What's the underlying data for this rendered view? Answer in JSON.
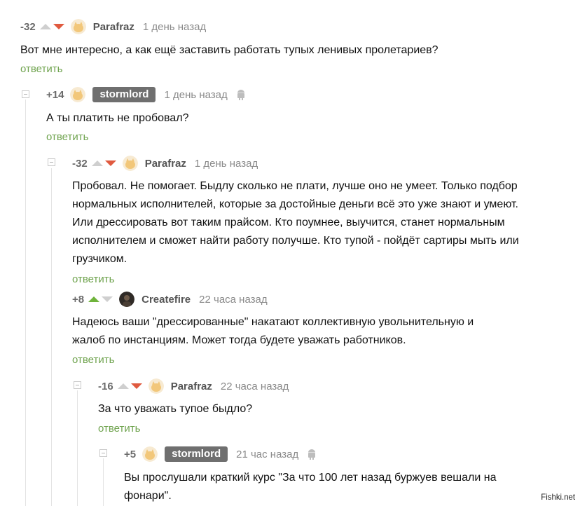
{
  "colors": {
    "upvote_active": "#6fb33b",
    "downvote_active": "#e05a3f",
    "reply": "#6fa34e",
    "op_badge": "#6f6f6f"
  },
  "comments": [
    {
      "rating": "-32",
      "vote": "down",
      "author": "Parafraz",
      "time": "1 день назад",
      "text": [
        "Вот мне интересно, а как ещё заставить работать тупых ленивых пролетариев?"
      ],
      "reply": "ответить",
      "avatar": "cat-avatar-icon"
    },
    {
      "rating": "+14",
      "vote": "up",
      "author": "stormlord",
      "time": "1 день назад",
      "text": [
        "А ты платить не пробовал?"
      ],
      "reply": "ответить",
      "avatar": "cat-avatar-icon",
      "device": "android-icon"
    },
    {
      "rating": "-32",
      "vote": "down",
      "author": "Parafraz",
      "time": "1 день назад",
      "text": [
        "Пробовал. Не помогает. Быдлу сколько не плати, лучше оно не умеет. Только подбор",
        "нормальных исполнителей, которые за достойные деньги всё это уже знают и умеют.",
        "Или дрессировать вот таким прайсом. Кто поумнее, выучится, станет нормальным",
        "исполнителем и сможет найти работу получше. Кто тупой - пойдёт сартиры мыть или",
        "грузчиком."
      ],
      "reply": "ответить",
      "avatar": "cat-avatar-icon"
    },
    {
      "rating": "+8",
      "vote": "up",
      "author": "Createfire",
      "time": "22 часа назад",
      "text": [
        "Надеюсь ваши \"дрессированные\"  накатают коллективную увольнительную и",
        "жалоб по инстанциям. Может тогда будете уважать работников."
      ],
      "reply": "ответить",
      "avatar": "dark-avatar-icon"
    },
    {
      "rating": "-16",
      "vote": "down",
      "author": "Parafraz",
      "time": "22 часа назад",
      "text": [
        "За что уважать тупое быдло?"
      ],
      "reply": "ответить",
      "avatar": "cat-avatar-icon"
    },
    {
      "rating": "+5",
      "vote": "up",
      "author": "stormlord",
      "time": "21 час назад",
      "text": [
        "Вы прослушали краткий курс \"За что 100 лет назад буржуев вешали на",
        "фонари\"."
      ],
      "avatar": "cat-avatar-icon",
      "device": "android-icon"
    }
  ],
  "watermark": "Fishki.net"
}
